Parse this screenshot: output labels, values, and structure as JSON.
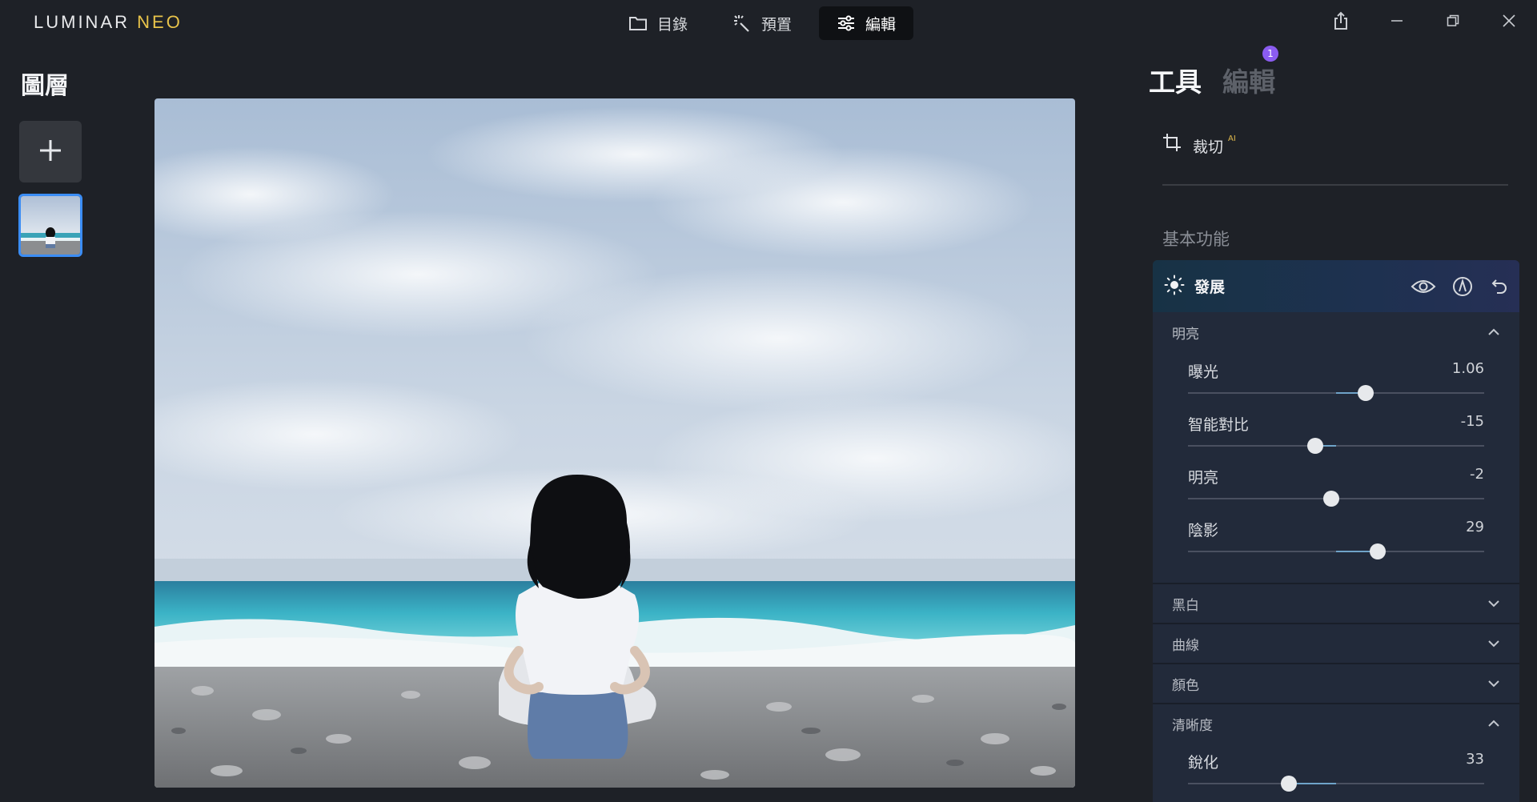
{
  "app": {
    "logo_main": "LUMINAR",
    "logo_accent": "NEO"
  },
  "nav": {
    "catalog": "目錄",
    "presets": "預置",
    "edit": "編輯"
  },
  "layers": {
    "title": "圖層"
  },
  "panel": {
    "tab_tools": "工具",
    "tab_edits": "編輯",
    "edits_badge": "1",
    "crop_label": "裁切",
    "crop_ai": "AI",
    "section_essentials": "基本功能",
    "tool_name": "發展",
    "group_light": "明亮",
    "group_bw": "黑白",
    "group_curves": "曲線",
    "group_color": "顏色",
    "group_details": "清晰度"
  },
  "sliders": {
    "exposure": {
      "label": "曝光",
      "value": "1.06",
      "pos": 0.6
    },
    "contrast": {
      "label": "智能對比",
      "value": "-15",
      "pos": 0.43
    },
    "light": {
      "label": "明亮",
      "value": "-2",
      "pos": 0.485
    },
    "shadows": {
      "label": "陰影",
      "value": "29",
      "pos": 0.64
    },
    "sharpen": {
      "label": "銳化",
      "value": "33",
      "pos": 0.34
    }
  },
  "colors": {
    "accent": "#3b8df5",
    "badge": "#8b5cf0",
    "logo_accent": "#e8c34a",
    "panel_bg": "#222a3a",
    "app_bg": "#1e2127"
  },
  "icons": {
    "catalog": "folder-icon",
    "presets": "magic-wand-icon",
    "edit": "sliders-icon",
    "share": "share-icon",
    "crop": "crop-icon",
    "tool": "sun-icon",
    "visibility": "eye-icon",
    "mask": "brush-mask-icon",
    "reset": "undo-icon"
  }
}
